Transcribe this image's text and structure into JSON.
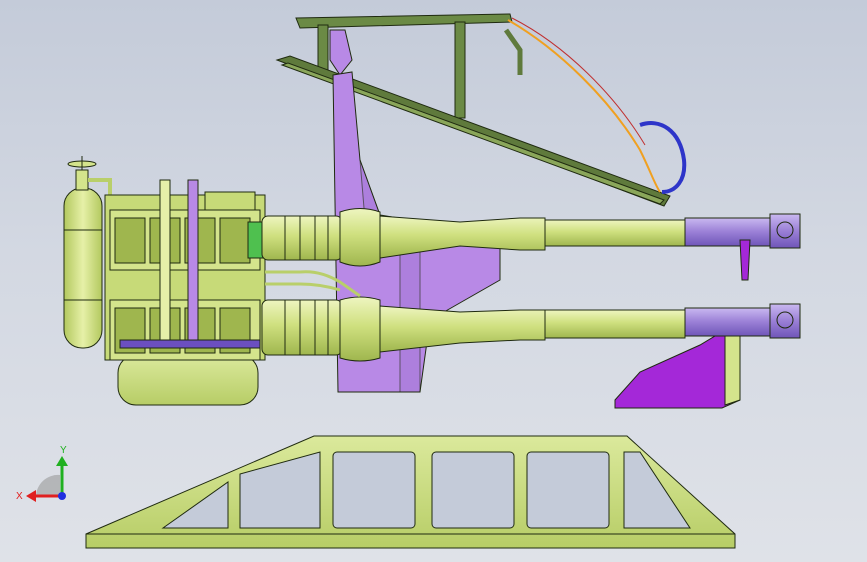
{
  "viewport": {
    "background_top": "#c4cbd9",
    "background_bottom": "#dfe2e8"
  },
  "model": {
    "outline_color": "#1f2a10",
    "body_color": "#d4e48c",
    "body_shade": "#b9cf6a",
    "frame_color": "#5f7a3c",
    "plate_color": "#b889e6",
    "bracket_color": "#a428d8",
    "muzzle_color": "#9a7fd6",
    "hose_color": "#2e35c9",
    "cable_color": "#f0a020"
  },
  "triad": {
    "x_label": "X",
    "y_label": "Y",
    "x_color": "#e02020",
    "y_color": "#20b020",
    "z_color": "#2030e0",
    "icon": "coordinate-triad-icon"
  }
}
